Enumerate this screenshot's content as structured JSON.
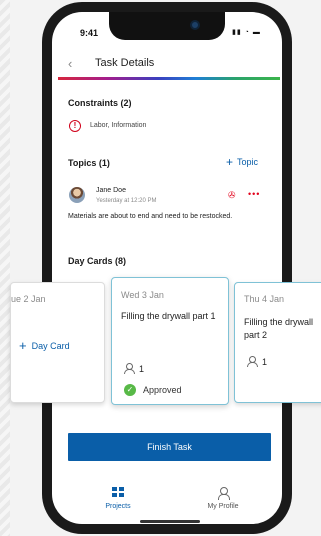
{
  "status_bar": {
    "time": "9:41",
    "icons": "▮▮ ◔ ▬"
  },
  "nav": {
    "back_icon": "‹",
    "title": "Task Details"
  },
  "constraints": {
    "heading": "Constraints (2)",
    "icon": "!",
    "text": "Labor, Information"
  },
  "topics": {
    "heading": "Topics (1)",
    "add_label": "Topic",
    "author": "Jane Doe",
    "time": "Yesterday at 12:20 PM",
    "text": "Materials are about to end and need to be restocked."
  },
  "day_cards": {
    "heading": "Day Cards (8)",
    "add_label": "Day Card",
    "cards": [
      {
        "date": "ue 2 Jan"
      },
      {
        "date": "Wed 3 Jan",
        "task": "Filling the drywall part 1",
        "people": "1",
        "status": "Approved"
      },
      {
        "date": "Thu 4 Jan",
        "task": "Filling the drywall part 2",
        "people": "1"
      }
    ]
  },
  "finish_button": "Finish Task",
  "tabs": [
    {
      "label": "Projects"
    },
    {
      "label": "My Profile"
    }
  ],
  "colors": {
    "brand_blue": "#0a5ea8",
    "alert_red": "#e2001a",
    "approved_green": "#58b947"
  }
}
